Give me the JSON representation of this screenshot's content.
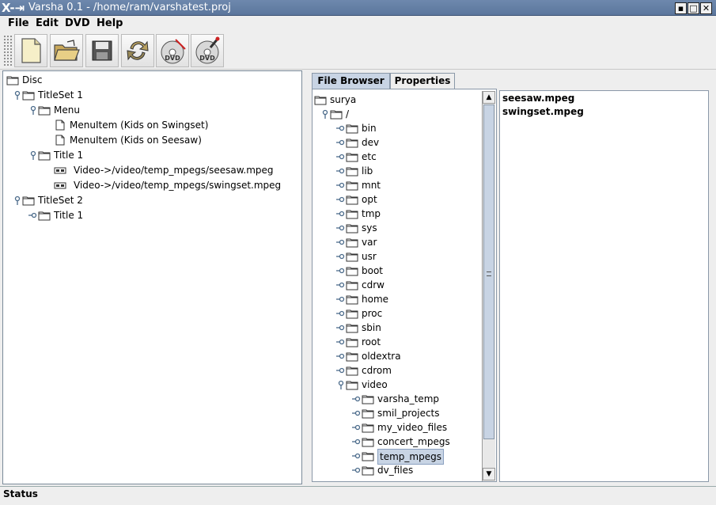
{
  "window": {
    "title": "Varsha 0.1 - /home/ram/varshatest.proj",
    "logo": "X-→х",
    "buttons": {
      "minimize": "▪",
      "maximize": "□",
      "close": "✕"
    }
  },
  "menu": [
    "File",
    "Edit",
    "DVD",
    "Help"
  ],
  "toolbar": {
    "icons": [
      "new-file-icon",
      "open-folder-icon",
      "save-disk-icon",
      "refresh-arrows-icon",
      "dvd-icon",
      "dvd-burn-icon"
    ],
    "dvd_label": "DVD"
  },
  "disc_tree": [
    {
      "label": "Disc",
      "icon": "folder",
      "depth": 0,
      "handle": "none"
    },
    {
      "label": "TitleSet 1",
      "icon": "folder",
      "depth": 1,
      "handle": "open"
    },
    {
      "label": "Menu",
      "icon": "folder",
      "depth": 2,
      "handle": "open"
    },
    {
      "label": "MenuItem (Kids on Swingset)",
      "icon": "document",
      "depth": 3,
      "handle": "none"
    },
    {
      "label": "MenuItem (Kids on Seesaw)",
      "icon": "document",
      "depth": 3,
      "handle": "none"
    },
    {
      "label": "Title 1",
      "icon": "folder",
      "depth": 2,
      "handle": "open"
    },
    {
      "label": "Video->/video/temp_mpegs/seesaw.mpeg",
      "icon": "film",
      "depth": 3,
      "handle": "none"
    },
    {
      "label": "Video->/video/temp_mpegs/swingset.mpeg",
      "icon": "film",
      "depth": 3,
      "handle": "none"
    },
    {
      "label": "TitleSet 2",
      "icon": "folder",
      "depth": 1,
      "handle": "open"
    },
    {
      "label": "Title 1",
      "icon": "folder",
      "depth": 2,
      "handle": "closed"
    }
  ],
  "tabs": [
    {
      "label": "File Browser",
      "selected": true
    },
    {
      "label": "Properties",
      "selected": false
    }
  ],
  "file_tree": [
    {
      "label": "surya",
      "depth": 0,
      "handle": "none",
      "selected": false
    },
    {
      "label": "/",
      "depth": 1,
      "handle": "open",
      "selected": false
    },
    {
      "label": "bin",
      "depth": 2,
      "handle": "closed",
      "selected": false
    },
    {
      "label": "dev",
      "depth": 2,
      "handle": "closed",
      "selected": false
    },
    {
      "label": "etc",
      "depth": 2,
      "handle": "closed",
      "selected": false
    },
    {
      "label": "lib",
      "depth": 2,
      "handle": "closed",
      "selected": false
    },
    {
      "label": "mnt",
      "depth": 2,
      "handle": "closed",
      "selected": false
    },
    {
      "label": "opt",
      "depth": 2,
      "handle": "closed",
      "selected": false
    },
    {
      "label": "tmp",
      "depth": 2,
      "handle": "closed",
      "selected": false
    },
    {
      "label": "sys",
      "depth": 2,
      "handle": "closed",
      "selected": false
    },
    {
      "label": "var",
      "depth": 2,
      "handle": "closed",
      "selected": false
    },
    {
      "label": "usr",
      "depth": 2,
      "handle": "closed",
      "selected": false
    },
    {
      "label": "boot",
      "depth": 2,
      "handle": "closed",
      "selected": false
    },
    {
      "label": "cdrw",
      "depth": 2,
      "handle": "closed",
      "selected": false
    },
    {
      "label": "home",
      "depth": 2,
      "handle": "closed",
      "selected": false
    },
    {
      "label": "proc",
      "depth": 2,
      "handle": "closed",
      "selected": false
    },
    {
      "label": "sbin",
      "depth": 2,
      "handle": "closed",
      "selected": false
    },
    {
      "label": "root",
      "depth": 2,
      "handle": "closed",
      "selected": false
    },
    {
      "label": "oldextra",
      "depth": 2,
      "handle": "closed",
      "selected": false
    },
    {
      "label": "cdrom",
      "depth": 2,
      "handle": "closed",
      "selected": false
    },
    {
      "label": "video",
      "depth": 2,
      "handle": "open",
      "selected": false
    },
    {
      "label": "varsha_temp",
      "depth": 3,
      "handle": "closed",
      "selected": false
    },
    {
      "label": "smil_projects",
      "depth": 3,
      "handle": "closed",
      "selected": false
    },
    {
      "label": "my_video_files",
      "depth": 3,
      "handle": "closed",
      "selected": false
    },
    {
      "label": "concert_mpegs",
      "depth": 3,
      "handle": "closed",
      "selected": false
    },
    {
      "label": "temp_mpegs",
      "depth": 3,
      "handle": "closed",
      "selected": true
    },
    {
      "label": "dv_files",
      "depth": 3,
      "handle": "closed",
      "selected": false
    }
  ],
  "files": [
    "seesaw.mpeg",
    "swingset.mpeg"
  ],
  "scrollbar": {
    "up": "▲",
    "down": "▼"
  },
  "status": "Status",
  "colors": {
    "titlebar": "#6e88ad",
    "selection": "#c8d4e4",
    "border": "#7a8a99"
  }
}
